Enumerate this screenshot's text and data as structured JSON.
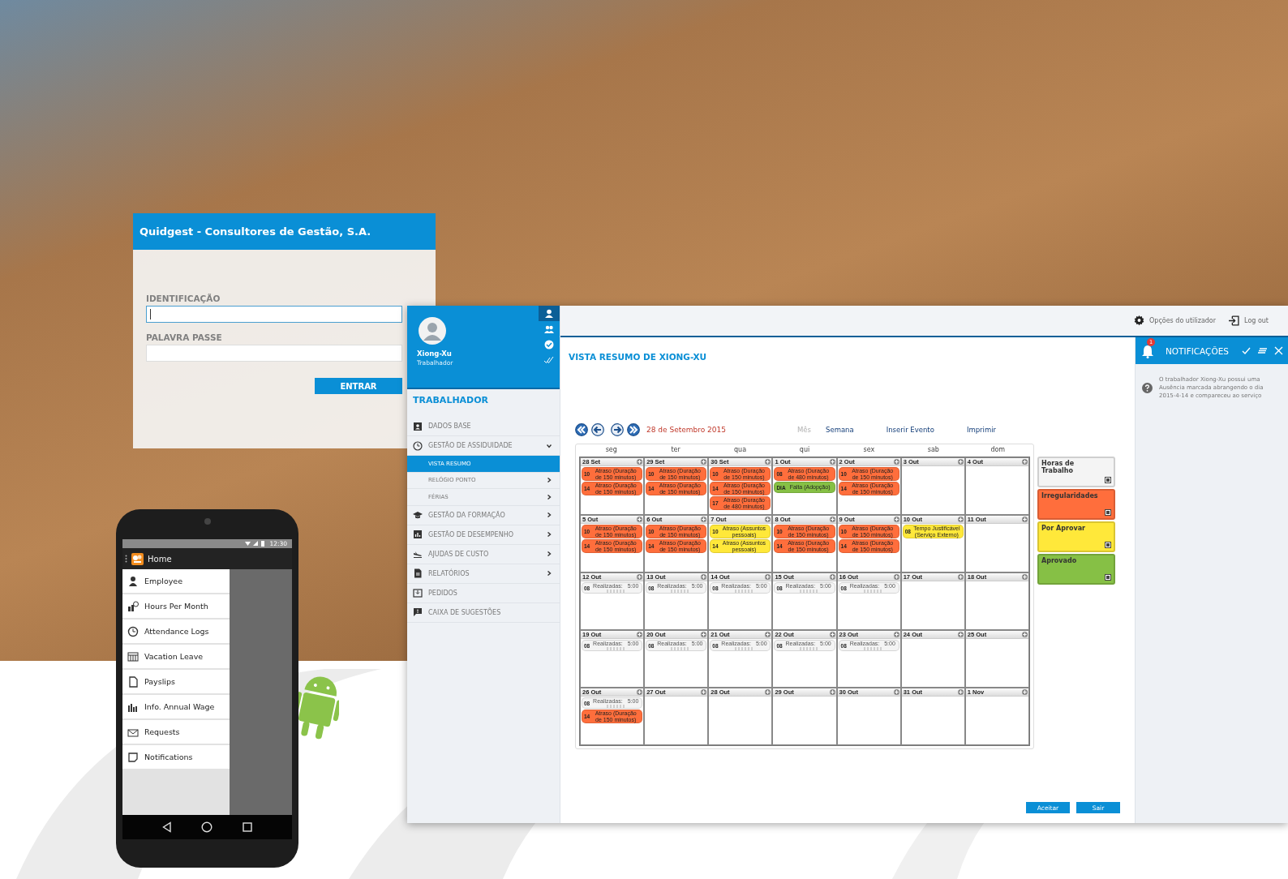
{
  "login": {
    "title": "Quidgest - Consultores de Gestão, S.A.",
    "fields": [
      {
        "label": "IDENTIFICAÇÃO",
        "focused": true
      },
      {
        "label": "PALAVRA PASSE",
        "focused": false
      }
    ],
    "button": "ENTRAR"
  },
  "phone": {
    "status_time": "12:30",
    "app_title": "Home",
    "menu": [
      {
        "label": "Employee"
      },
      {
        "label": "Hours Per Month"
      },
      {
        "label": "Attendance Logs"
      },
      {
        "label": "Vacation Leave"
      },
      {
        "label": "Payslips"
      },
      {
        "label": "Info. Annual Wage"
      },
      {
        "label": "Requests"
      },
      {
        "label": "Notifications"
      }
    ]
  },
  "app": {
    "user": {
      "name": "Xiong-Xu",
      "role": "Trabalhador"
    },
    "rail": [
      {
        "selected": true
      },
      {
        "selected": false
      },
      {
        "selected": false
      },
      {
        "selected": false
      }
    ],
    "sidebar": {
      "title": "TRABALHADOR",
      "items": [
        {
          "label": "DADOS BASE",
          "kind": "link",
          "selected": false
        },
        {
          "label": "GESTÃO DE ASSIDUIDADE",
          "kind": "group",
          "expanded": true,
          "selected": false,
          "children": [
            {
              "label": "VISTA RESUMO",
              "kind": "link",
              "selected": true
            },
            {
              "label": "RELÓGIO PONTO",
              "kind": "group",
              "expanded": false,
              "selected": false
            },
            {
              "label": "FÉRIAS",
              "kind": "group",
              "expanded": false,
              "selected": false
            }
          ]
        },
        {
          "label": "GESTÃO DA FORMAÇÃO",
          "kind": "group",
          "expanded": false,
          "selected": false
        },
        {
          "label": "GESTÃO DE DESEMPENHO",
          "kind": "group",
          "expanded": false,
          "selected": false
        },
        {
          "label": "AJUDAS DE CUSTO",
          "kind": "group",
          "expanded": false,
          "selected": false
        },
        {
          "label": "RELATÓRIOS",
          "kind": "group",
          "expanded": false,
          "selected": false
        },
        {
          "label": "PEDIDOS",
          "kind": "link",
          "selected": false
        },
        {
          "label": "CAIXA DE SUGESTÕES",
          "kind": "link",
          "selected": false
        }
      ]
    },
    "top_bar": {
      "options": "Opções do utilizador",
      "logout": "Log out"
    },
    "title": "VISTA RESUMO DE XIONG-XU",
    "toolbar": {
      "date": "28 de Setembro 2015",
      "views": [
        {
          "label": "Mês",
          "selected": true
        },
        {
          "label": "Semana",
          "selected": false
        },
        {
          "label": "Inserir Evento",
          "selected": false
        },
        {
          "label": "Imprimir",
          "selected": false
        }
      ]
    },
    "calendar": {
      "weekdays": [
        "seg",
        "ter",
        "qua",
        "qui",
        "sex",
        "sab",
        "dom"
      ],
      "weeks": [
        {
          "days": [
            {
              "label": "28 Set",
              "events": [
                {
                  "kind": "irregular",
                  "code": "10",
                  "text": "Atraso (Duração de 150 minutos)"
                },
                {
                  "kind": "irregular",
                  "code": "14",
                  "text": "Atraso (Duração de 150 minutos)"
                }
              ]
            },
            {
              "label": "29 Set",
              "events": [
                {
                  "kind": "irregular",
                  "code": "10",
                  "text": "Atraso (Duração de 150 minutos)"
                },
                {
                  "kind": "irregular",
                  "code": "14",
                  "text": "Atraso (Duração de 150 minutos)"
                }
              ]
            },
            {
              "label": "30 Set",
              "events": [
                {
                  "kind": "irregular",
                  "code": "10",
                  "text": "Atraso (Duração de 150 minutos)"
                },
                {
                  "kind": "irregular",
                  "code": "14",
                  "text": "Atraso (Duração de 150 minutos)"
                },
                {
                  "kind": "irregular",
                  "code": "17",
                  "text": "Atraso (Duração de 480 minutos)"
                }
              ]
            },
            {
              "label": "1 Out",
              "events": [
                {
                  "kind": "irregular",
                  "code": "08",
                  "text": "Atraso (Duração de 480 minutos)"
                },
                {
                  "kind": "approved",
                  "code": "DIA",
                  "text": "Falta (Adopção)"
                }
              ]
            },
            {
              "label": "2 Out",
              "events": [
                {
                  "kind": "irregular",
                  "code": "10",
                  "text": "Atraso (Duração de 150 minutos)"
                },
                {
                  "kind": "irregular",
                  "code": "14",
                  "text": "Atraso (Duração de 150 minutos)"
                }
              ]
            },
            {
              "label": "3 Out"
            },
            {
              "label": "4 Out"
            }
          ]
        },
        {
          "days": [
            {
              "label": "5 Out",
              "events": [
                {
                  "kind": "irregular",
                  "code": "10",
                  "text": "Atraso (Duração de 150 minutos)"
                },
                {
                  "kind": "irregular",
                  "code": "14",
                  "text": "Atraso (Duração de 150 minutos)"
                }
              ]
            },
            {
              "label": "6 Out",
              "events": [
                {
                  "kind": "irregular",
                  "code": "10",
                  "text": "Atraso (Duração de 150 minutos)"
                },
                {
                  "kind": "irregular",
                  "code": "14",
                  "text": "Atraso (Duração de 150 minutos)"
                }
              ]
            },
            {
              "label": "7 Out",
              "events": [
                {
                  "kind": "pending",
                  "code": "10",
                  "text": "Atraso (Assuntos pessoais)"
                },
                {
                  "kind": "pending",
                  "code": "14",
                  "text": "Atraso (Assuntos pessoais)"
                }
              ]
            },
            {
              "label": "8 Out",
              "events": [
                {
                  "kind": "irregular",
                  "code": "10",
                  "text": "Atraso (Duração de 150 minutos)"
                },
                {
                  "kind": "irregular",
                  "code": "14",
                  "text": "Atraso (Duração de 150 minutos)"
                }
              ]
            },
            {
              "label": "9 Out",
              "events": [
                {
                  "kind": "irregular",
                  "code": "10",
                  "text": "Atraso (Duração de 150 minutos)"
                },
                {
                  "kind": "irregular",
                  "code": "14",
                  "text": "Atraso (Duração de 150 minutos)"
                }
              ]
            },
            {
              "label": "10 Out",
              "events": [
                {
                  "kind": "pending",
                  "code": "08",
                  "text": "Tempo Justificável (Serviço Externo)"
                }
              ]
            },
            {
              "label": "11 Out"
            }
          ]
        },
        {
          "days": [
            {
              "label": "12 Out",
              "events": [
                {
                  "kind": "hours",
                  "code": "08",
                  "text": "Realizadas:",
                  "value": "5:00"
                }
              ]
            },
            {
              "label": "13 Out",
              "events": [
                {
                  "kind": "hours",
                  "code": "08",
                  "text": "Realizadas:",
                  "value": "5:00"
                }
              ]
            },
            {
              "label": "14 Out",
              "events": [
                {
                  "kind": "hours",
                  "code": "08",
                  "text": "Realizadas:",
                  "value": "5:00"
                }
              ]
            },
            {
              "label": "15 Out",
              "events": [
                {
                  "kind": "hours",
                  "code": "08",
                  "text": "Realizadas:",
                  "value": "5:00"
                }
              ]
            },
            {
              "label": "16 Out",
              "events": [
                {
                  "kind": "hours",
                  "code": "08",
                  "text": "Realizadas:",
                  "value": "5:00"
                }
              ]
            },
            {
              "label": "17 Out"
            },
            {
              "label": "18 Out"
            }
          ]
        },
        {
          "days": [
            {
              "label": "19 Out",
              "events": [
                {
                  "kind": "hours",
                  "code": "08",
                  "text": "Realizadas:",
                  "value": "5:00"
                }
              ]
            },
            {
              "label": "20 Out",
              "events": [
                {
                  "kind": "hours",
                  "code": "08",
                  "text": "Realizadas:",
                  "value": "5:00"
                }
              ]
            },
            {
              "label": "21 Out",
              "events": [
                {
                  "kind": "hours",
                  "code": "08",
                  "text": "Realizadas:",
                  "value": "5:00"
                }
              ]
            },
            {
              "label": "22 Out",
              "events": [
                {
                  "kind": "hours",
                  "code": "08",
                  "text": "Realizadas:",
                  "value": "5:00"
                }
              ]
            },
            {
              "label": "23 Out",
              "events": [
                {
                  "kind": "hours",
                  "code": "08",
                  "text": "Realizadas:",
                  "value": "5:00"
                }
              ]
            },
            {
              "label": "24 Out"
            },
            {
              "label": "25 Out"
            }
          ]
        },
        {
          "days": [
            {
              "label": "26 Out",
              "events": [
                {
                  "kind": "hours",
                  "code": "08",
                  "text": "Realizadas:",
                  "value": "5:00"
                },
                {
                  "kind": "irregular",
                  "code": "14",
                  "text": "Atraso (Duração de 150 minutos)"
                }
              ]
            },
            {
              "label": "27 Out"
            },
            {
              "label": "28 Out"
            },
            {
              "label": "29 Out"
            },
            {
              "label": "30 Out"
            },
            {
              "label": "31 Out"
            },
            {
              "label": "1 Nov"
            }
          ]
        }
      ]
    },
    "legend": [
      {
        "label": "Horas de Trabalho",
        "color": "#f4f4f4",
        "checked": true
      },
      {
        "label": "Irregularidades",
        "color": "#ff6e3c",
        "checked": true
      },
      {
        "label": "Por Aprovar",
        "color": "#ffe83a",
        "checked": true
      },
      {
        "label": "Aprovado",
        "color": "#86c045",
        "checked": true
      }
    ],
    "buttons": [
      "Aceitar",
      "Sair"
    ],
    "notifications": {
      "title": "NOTIFICAÇÕES",
      "badge": "1",
      "items": [
        {
          "text": "O trabalhador Xiong-Xu possui uma Ausência marcada abrangendo o dia 2015-4-14 e compareceu ao serviço"
        }
      ]
    }
  }
}
